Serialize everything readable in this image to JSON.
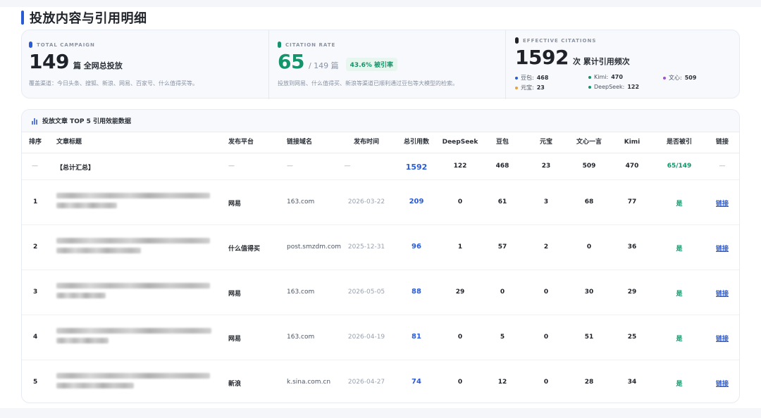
{
  "page": {
    "title": "投放内容与引用明细"
  },
  "stats": {
    "campaign": {
      "label": "TOTAL CAMPAIGN",
      "value": "149",
      "unit": "篇 全网总投放",
      "desc": "覆盖渠道：今日头条、搜狐、新浪、网易、百家号、什么值得买等。",
      "dot_color": "#2a5bd7"
    },
    "citation": {
      "label": "CITATION RATE",
      "value": "65",
      "unit": "/ 149 篇",
      "badge": "43.6% 被引率",
      "desc": "投放到网易、什么值得买、新浪等渠道已顺利通过豆包等大模型的检索。",
      "dot_color": "#13946a"
    },
    "effective": {
      "label": "EFFECTIVE CITATIONS",
      "value": "1592",
      "unit": "次 累计引用频次",
      "dot_color": "#1f2329",
      "models": [
        {
          "name": "豆包:",
          "value": "468",
          "color": "#2a5bd7"
        },
        {
          "name": "Kimi:",
          "value": "470",
          "color": "#13946a"
        },
        {
          "name": "文心:",
          "value": "509",
          "color": "#a050d8"
        },
        {
          "name": "元宝:",
          "value": "23",
          "color": "#e8a33c"
        },
        {
          "name": "DeepSeek:",
          "value": "122",
          "color": "#13946a"
        }
      ]
    }
  },
  "table": {
    "title": "投放文章 TOP 5 引用效能数据",
    "headers": [
      "排序",
      "文章标题",
      "发布平台",
      "链接域名",
      "发布时间",
      "总引用数",
      "DeepSeek",
      "豆包",
      "元宝",
      "文心一言",
      "Kimi",
      "是否被引",
      "链接"
    ],
    "summary": {
      "rank": "—",
      "title": "【总计汇总】",
      "platform": "—",
      "domain": "—",
      "date": "—",
      "total": "1592",
      "deepseek": "122",
      "doubao": "468",
      "yuanbao": "23",
      "wenxin": "509",
      "kimi": "470",
      "cited": "65/149",
      "link": "—"
    },
    "rows": [
      {
        "rank": "1",
        "platform": "网易",
        "domain": "163.com",
        "date": "2026-03-22",
        "total": "209",
        "deepseek": "0",
        "doubao": "61",
        "yuanbao": "3",
        "wenxin": "68",
        "kimi": "77",
        "cited": "是",
        "link": "链接"
      },
      {
        "rank": "2",
        "platform": "什么值得买",
        "domain": "post.smzdm.com",
        "date": "2025-12-31",
        "total": "96",
        "deepseek": "1",
        "doubao": "57",
        "yuanbao": "2",
        "wenxin": "0",
        "kimi": "36",
        "cited": "是",
        "link": "链接"
      },
      {
        "rank": "3",
        "platform": "网易",
        "domain": "163.com",
        "date": "2026-05-05",
        "total": "88",
        "deepseek": "29",
        "doubao": "0",
        "yuanbao": "0",
        "wenxin": "30",
        "kimi": "29",
        "cited": "是",
        "link": "链接"
      },
      {
        "rank": "4",
        "platform": "网易",
        "domain": "163.com",
        "date": "2026-04-19",
        "total": "81",
        "deepseek": "0",
        "doubao": "5",
        "yuanbao": "0",
        "wenxin": "51",
        "kimi": "25",
        "cited": "是",
        "link": "链接"
      },
      {
        "rank": "5",
        "platform": "新浪",
        "domain": "k.sina.com.cn",
        "date": "2026-04-27",
        "total": "74",
        "deepseek": "0",
        "doubao": "12",
        "yuanbao": "0",
        "wenxin": "28",
        "kimi": "34",
        "cited": "是",
        "link": "链接"
      }
    ]
  }
}
